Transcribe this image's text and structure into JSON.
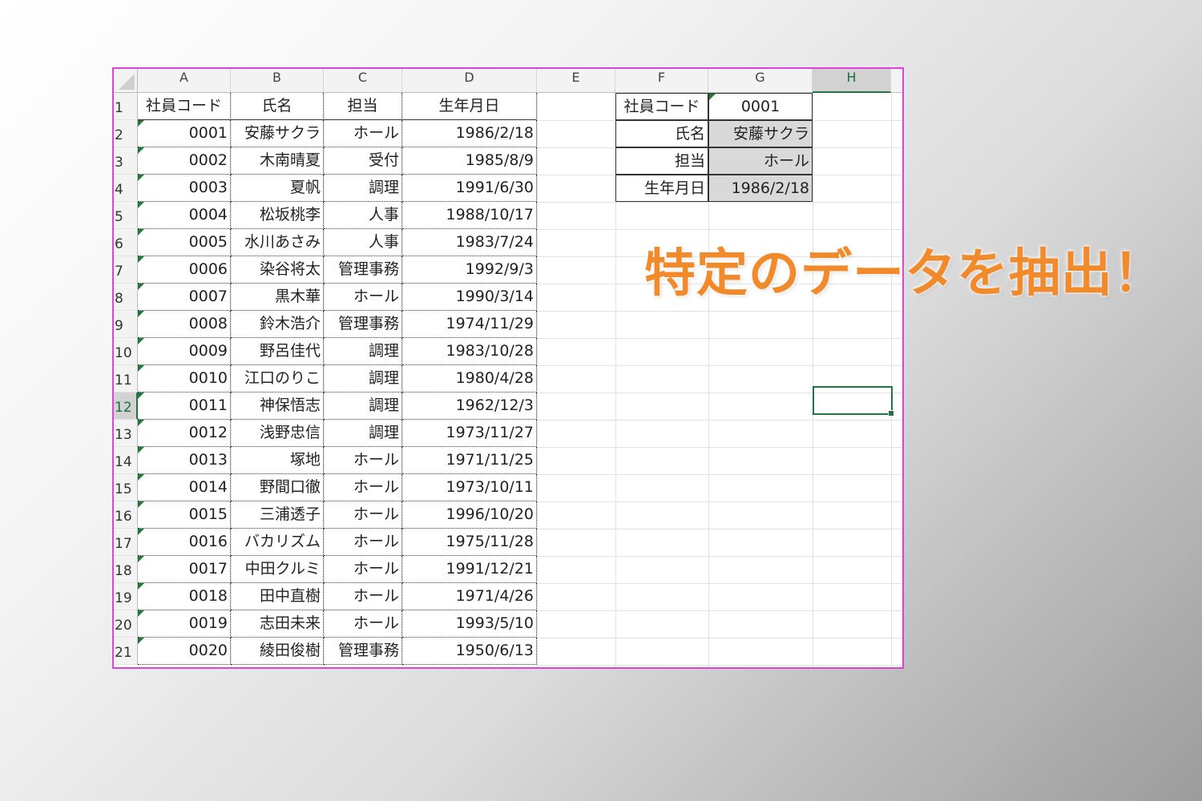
{
  "columns": [
    "A",
    "B",
    "C",
    "D",
    "E",
    "F",
    "G",
    "H"
  ],
  "selected_column": "H",
  "selected_row": "12",
  "row_numbers": [
    "1",
    "2",
    "3",
    "4",
    "5",
    "6",
    "7",
    "8",
    "9",
    "10",
    "11",
    "12",
    "13",
    "14",
    "15",
    "16",
    "17",
    "18",
    "19",
    "20",
    "21"
  ],
  "table": {
    "headers": [
      "社員コード",
      "氏名",
      "担当",
      "生年月日"
    ],
    "rows": [
      {
        "code": "0001",
        "name": "安藤サクラ",
        "role": "ホール",
        "dob": "1986/2/18"
      },
      {
        "code": "0002",
        "name": "木南晴夏",
        "role": "受付",
        "dob": "1985/8/9"
      },
      {
        "code": "0003",
        "name": "夏帆",
        "role": "調理",
        "dob": "1991/6/30"
      },
      {
        "code": "0004",
        "name": "松坂桃李",
        "role": "人事",
        "dob": "1988/10/17"
      },
      {
        "code": "0005",
        "name": "水川あさみ",
        "role": "人事",
        "dob": "1983/7/24"
      },
      {
        "code": "0006",
        "name": "染谷将太",
        "role": "管理事務",
        "dob": "1992/9/3"
      },
      {
        "code": "0007",
        "name": "黒木華",
        "role": "ホール",
        "dob": "1990/3/14"
      },
      {
        "code": "0008",
        "name": "鈴木浩介",
        "role": "管理事務",
        "dob": "1974/11/29"
      },
      {
        "code": "0009",
        "name": "野呂佳代",
        "role": "調理",
        "dob": "1983/10/28"
      },
      {
        "code": "0010",
        "name": "江口のりこ",
        "role": "調理",
        "dob": "1980/4/28"
      },
      {
        "code": "0011",
        "name": "神保悟志",
        "role": "調理",
        "dob": "1962/12/3"
      },
      {
        "code": "0012",
        "name": "浅野忠信",
        "role": "調理",
        "dob": "1973/11/27"
      },
      {
        "code": "0013",
        "name": "塚地",
        "role": "ホール",
        "dob": "1971/11/25"
      },
      {
        "code": "0014",
        "name": "野間口徹",
        "role": "ホール",
        "dob": "1973/10/11"
      },
      {
        "code": "0015",
        "name": "三浦透子",
        "role": "ホール",
        "dob": "1996/10/20"
      },
      {
        "code": "0016",
        "name": "バカリズム",
        "role": "ホール",
        "dob": "1975/11/28"
      },
      {
        "code": "0017",
        "name": "中田クルミ",
        "role": "ホール",
        "dob": "1991/12/21"
      },
      {
        "code": "0018",
        "name": "田中直樹",
        "role": "ホール",
        "dob": "1971/4/26"
      },
      {
        "code": "0019",
        "name": "志田未来",
        "role": "ホール",
        "dob": "1993/5/10"
      },
      {
        "code": "0020",
        "name": "綾田俊樹",
        "role": "管理事務",
        "dob": "1950/6/13"
      }
    ]
  },
  "lookup": {
    "labels": [
      "社員コード",
      "氏名",
      "担当",
      "生年月日"
    ],
    "values": [
      "0001",
      "安藤サクラ",
      "ホール",
      "1986/2/18"
    ]
  },
  "callout": "特定のデータを抽出！",
  "colors": {
    "callout": "#f08a2a",
    "frame": "#e040e0",
    "selection": "#217346",
    "lookup_fill": "#d9d9d9"
  }
}
